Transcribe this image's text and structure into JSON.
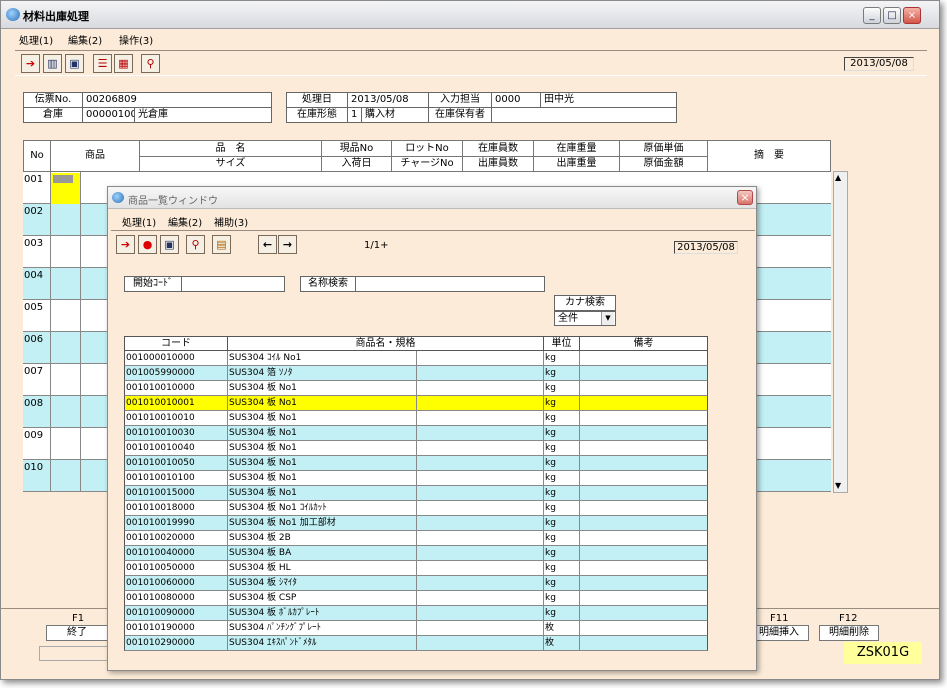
{
  "window": {
    "title": "材料出庫処理",
    "min": "_",
    "max": "□",
    "close": "×"
  },
  "menu": [
    "処理(1)",
    "編集(2)",
    "操作(3)"
  ],
  "toolbar": {
    "date": "2013/05/08"
  },
  "header": {
    "slip_label": "伝票No.",
    "slip_value": "00206809",
    "warehouse_label": "倉庫",
    "warehouse_code": "00000100",
    "warehouse_name": "光倉庫",
    "proc_date_label": "処理日",
    "proc_date": "2013/05/08",
    "input_person_label": "入力担当",
    "input_person_code": "0000",
    "input_person_name": "田中光",
    "stock_form_label": "在庫形態",
    "stock_form_code": "1",
    "stock_form_name": "購入材",
    "stock_holder_label": "在庫保有者"
  },
  "grid": {
    "headers": {
      "no": "No",
      "product": "商品",
      "name": "品　名",
      "size": "サイズ",
      "genpin": "現品No",
      "nyuka": "入荷日",
      "lot": "ロットNo",
      "charge": "チャージNo",
      "zaiko_qty": "在庫員数",
      "shukko_qty": "出庫員数",
      "zaiko_wt": "在庫重量",
      "shukko_wt": "出庫重量",
      "tanka": "原価単価",
      "kingaku": "原価金額",
      "tekiyo": "摘　要"
    },
    "rows": [
      "001",
      "002",
      "003",
      "004",
      "005",
      "006",
      "007",
      "008",
      "009",
      "010"
    ]
  },
  "fkeys": [
    {
      "key": "F1",
      "label": "終了"
    },
    {
      "key": "F11",
      "label": "明細挿入"
    },
    {
      "key": "F12",
      "label": "明細削除"
    }
  ],
  "screen_id": "ZSK01G",
  "popup": {
    "title": "商品一覧ウィンドウ",
    "menu": [
      "処理(1)",
      "編集(2)",
      "補助(3)"
    ],
    "page": "1/1+",
    "date": "2013/05/08",
    "start_code_label": "開始ｺｰﾄﾞ",
    "name_search_label": "名称検索",
    "kana_label": "カナ検索",
    "kana_value": "全件",
    "columns": {
      "code": "コード",
      "name": "商品名・規格",
      "unit": "単位",
      "note": "備考"
    },
    "items": [
      {
        "code": "001000010000",
        "name": "SUS304 ｺｲﾙ No1",
        "unit": "kg"
      },
      {
        "code": "001005990000",
        "name": "SUS304 箔 ｿﾉﾀ",
        "unit": "kg"
      },
      {
        "code": "001010010000",
        "name": "SUS304 板 No1",
        "unit": "kg"
      },
      {
        "code": "001010010001",
        "name": "SUS304 板 No1",
        "unit": "kg"
      },
      {
        "code": "001010010010",
        "name": "SUS304 板 No1",
        "unit": "kg"
      },
      {
        "code": "001010010030",
        "name": "SUS304 板 No1",
        "unit": "kg"
      },
      {
        "code": "001010010040",
        "name": "SUS304 板 No1",
        "unit": "kg"
      },
      {
        "code": "001010010050",
        "name": "SUS304 板 No1",
        "unit": "kg"
      },
      {
        "code": "001010010100",
        "name": "SUS304 板 No1",
        "unit": "kg"
      },
      {
        "code": "001010015000",
        "name": "SUS304 板 No1",
        "unit": "kg"
      },
      {
        "code": "001010018000",
        "name": "SUS304 板 No1 ｺｲﾙｶｯﾄ",
        "unit": "kg"
      },
      {
        "code": "001010019990",
        "name": "SUS304 板 No1 加工部材",
        "unit": "kg"
      },
      {
        "code": "001010020000",
        "name": "SUS304 板 2B",
        "unit": "kg"
      },
      {
        "code": "001010040000",
        "name": "SUS304 板 BA",
        "unit": "kg"
      },
      {
        "code": "001010050000",
        "name": "SUS304 板 HL",
        "unit": "kg"
      },
      {
        "code": "001010060000",
        "name": "SUS304 板 ｼﾏｲﾀ",
        "unit": "kg"
      },
      {
        "code": "001010080000",
        "name": "SUS304 板 CSP",
        "unit": "kg"
      },
      {
        "code": "001010090000",
        "name": "SUS304 板 ﾎﾞﾙｶﾌﾟﾚｰﾄ",
        "unit": "kg"
      },
      {
        "code": "001010190000",
        "name": "SUS304 ﾊﾟﾝﾁﾝｸﾞﾌﾟﾚｰﾄ",
        "unit": "枚"
      },
      {
        "code": "001010290000",
        "name": "SUS304 ｴｷｽﾊﾟﾝﾄﾞﾒﾀﾙ",
        "unit": "枚"
      }
    ],
    "selected_index": 3
  }
}
